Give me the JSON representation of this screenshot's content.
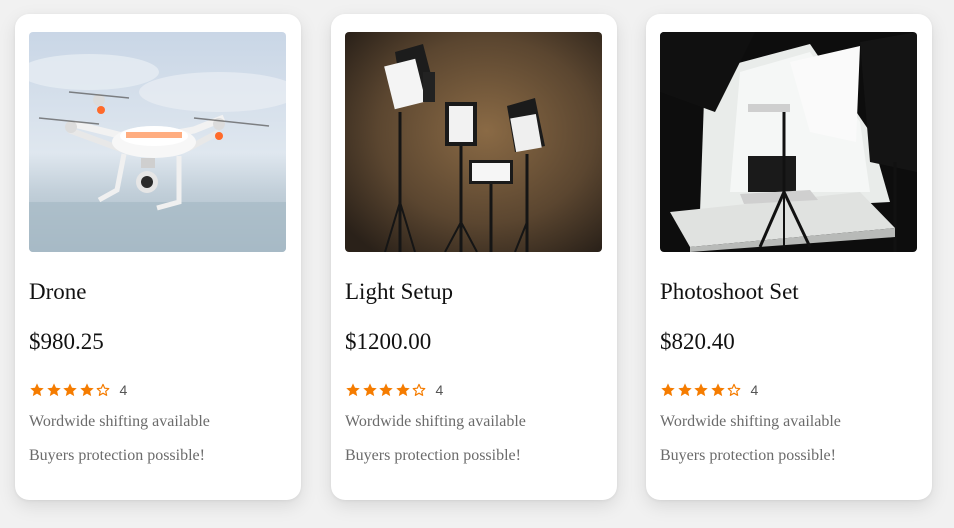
{
  "colors": {
    "star": "#f57c00",
    "text": "#111111",
    "muted": "#6b6b6b"
  },
  "products": [
    {
      "title": "Drone",
      "price": "$980.25",
      "rating": 4,
      "rating_label": "4",
      "shipping": "Wordwide shifting available",
      "protection": "Buyers protection possible!",
      "image": "drone-photo"
    },
    {
      "title": "Light Setup",
      "price": "$1200.00",
      "rating": 4,
      "rating_label": "4",
      "shipping": "Wordwide shifting available",
      "protection": "Buyers protection possible!",
      "image": "light-setup-photo"
    },
    {
      "title": "Photoshoot Set",
      "price": "$820.40",
      "rating": 4,
      "rating_label": "4",
      "shipping": "Wordwide shifting available",
      "protection": "Buyers protection possible!",
      "image": "photoshoot-set-photo"
    }
  ]
}
